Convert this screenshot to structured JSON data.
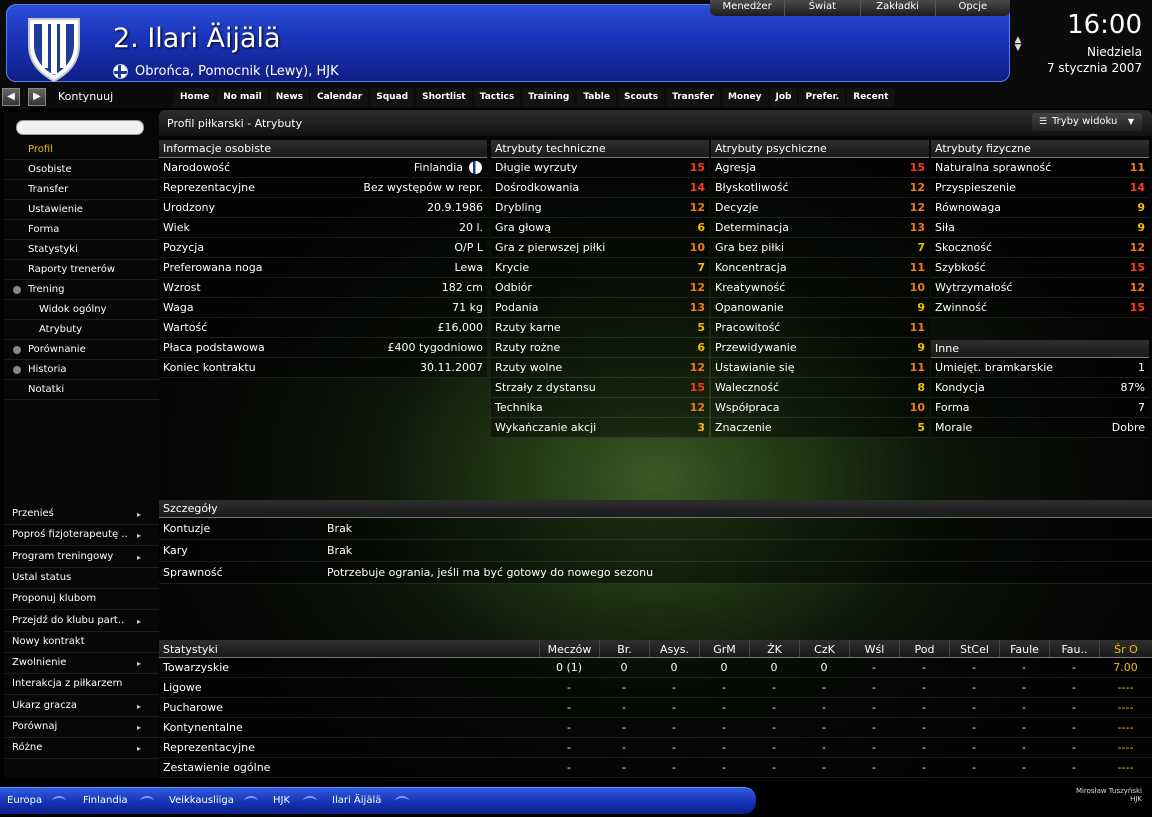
{
  "header": {
    "name": "2. Ilari Äijälä",
    "subtitle": "Obrońca, Pomocnik (Lewy), HJK",
    "menu": [
      "Menedżer",
      "Świat",
      "Zakładki",
      "Opcje"
    ],
    "time": "16:00",
    "day": "Niedziela",
    "date": "7 stycznia 2007",
    "colors": {
      "banner": "#1a33b8",
      "shield": "#1e3c9c"
    }
  },
  "nav": {
    "continue_label": "Kontynuuj",
    "links": [
      "Home",
      "No mail",
      "News",
      "Calendar",
      "Squad",
      "Shortlist",
      "Tactics",
      "Training",
      "Table",
      "Scouts",
      "Transfer",
      "Money",
      "Job",
      "Prefer.",
      "Recent"
    ]
  },
  "sidebar": {
    "items": [
      {
        "label": "Profil",
        "active": true,
        "sub": false,
        "icon": ""
      },
      {
        "label": "Osobiste",
        "active": false,
        "sub": false,
        "icon": ""
      },
      {
        "label": "Transfer",
        "active": false,
        "sub": false,
        "icon": ""
      },
      {
        "label": "Ustawienie",
        "active": false,
        "sub": false,
        "icon": ""
      },
      {
        "label": "Forma",
        "active": false,
        "sub": false,
        "icon": ""
      },
      {
        "label": "Statystyki",
        "active": false,
        "sub": false,
        "icon": ""
      },
      {
        "label": "Raporty trenerów",
        "active": false,
        "sub": false,
        "icon": ""
      },
      {
        "label": "Trening",
        "active": false,
        "sub": false,
        "icon": "collapse-icon"
      },
      {
        "label": "Widok ogólny",
        "active": false,
        "sub": true,
        "icon": ""
      },
      {
        "label": "Atrybuty",
        "active": false,
        "sub": true,
        "icon": ""
      },
      {
        "label": "Porównanie",
        "active": false,
        "sub": false,
        "icon": "expand-icon"
      },
      {
        "label": "Historia",
        "active": false,
        "sub": false,
        "icon": "expand-icon"
      },
      {
        "label": "Notatki",
        "active": false,
        "sub": false,
        "icon": ""
      }
    ],
    "actions": [
      "Przenieś",
      "Poproś fizjoterapeutę ..",
      "Program treningowy",
      "Ustal status",
      "Proponuj klubom",
      "Przejdź do klubu part..",
      "Nowy kontrakt",
      "Zwolnienie",
      "Interakcja z piłkarzem",
      "Ukarz gracza",
      "Porównaj",
      "Różne"
    ],
    "actions_with_arrow": [
      0,
      1,
      2,
      5,
      7,
      9,
      10,
      11
    ]
  },
  "main": {
    "title": "Profil piłkarski - Atrybuty",
    "view_button": "Tryby widoku"
  },
  "personal": {
    "header": "Informacje osobiste",
    "rows": [
      {
        "k": "Narodowość",
        "v": "Finlandia"
      },
      {
        "k": "Reprezentacyjne",
        "v": "Bez występów w repr."
      },
      {
        "k": "Urodzony",
        "v": "20.9.1986"
      },
      {
        "k": "Wiek",
        "v": "20 l."
      },
      {
        "k": "Pozycja",
        "v": "O/P L"
      },
      {
        "k": "Preferowana noga",
        "v": "Lewa"
      },
      {
        "k": "Wzrost",
        "v": "182 cm"
      },
      {
        "k": "Waga",
        "v": "71 kg"
      },
      {
        "k": "Wartość",
        "v": "£16,000"
      },
      {
        "k": "Płaca podstawowa",
        "v": "£400 tygodniowo"
      },
      {
        "k": "Koniec kontraktu",
        "v": "30.11.2007"
      }
    ]
  },
  "technical": {
    "header": "Atrybuty techniczne",
    "rows": [
      {
        "k": "Długie wyrzuty",
        "v": "15",
        "c": "r"
      },
      {
        "k": "Dośrodkowania",
        "v": "14",
        "c": "r"
      },
      {
        "k": "Drybling",
        "v": "12",
        "c": "o"
      },
      {
        "k": "Gra głową",
        "v": "6",
        "c": "y"
      },
      {
        "k": "Gra z pierwszej piłki",
        "v": "10",
        "c": "o"
      },
      {
        "k": "Krycie",
        "v": "7",
        "c": "y"
      },
      {
        "k": "Odbiór",
        "v": "12",
        "c": "o"
      },
      {
        "k": "Podania",
        "v": "13",
        "c": "o"
      },
      {
        "k": "Rzuty karne",
        "v": "5",
        "c": "y"
      },
      {
        "k": "Rzuty rożne",
        "v": "6",
        "c": "y"
      },
      {
        "k": "Rzuty wolne",
        "v": "12",
        "c": "o"
      },
      {
        "k": "Strzały z dystansu",
        "v": "15",
        "c": "r"
      },
      {
        "k": "Technika",
        "v": "12",
        "c": "o"
      },
      {
        "k": "Wykańczanie akcji",
        "v": "3",
        "c": "y"
      }
    ]
  },
  "mental": {
    "header": "Atrybuty psychiczne",
    "rows": [
      {
        "k": "Agresja",
        "v": "15",
        "c": "r"
      },
      {
        "k": "Błyskotliwość",
        "v": "12",
        "c": "o"
      },
      {
        "k": "Decyzje",
        "v": "12",
        "c": "o"
      },
      {
        "k": "Determinacja",
        "v": "13",
        "c": "o"
      },
      {
        "k": "Gra bez piłki",
        "v": "7",
        "c": "y"
      },
      {
        "k": "Koncentracja",
        "v": "11",
        "c": "o"
      },
      {
        "k": "Kreatywność",
        "v": "10",
        "c": "o"
      },
      {
        "k": "Opanowanie",
        "v": "9",
        "c": "y"
      },
      {
        "k": "Pracowitość",
        "v": "11",
        "c": "o"
      },
      {
        "k": "Przewidywanie",
        "v": "9",
        "c": "y"
      },
      {
        "k": "Ustawianie się",
        "v": "11",
        "c": "o"
      },
      {
        "k": "Waleczność",
        "v": "8",
        "c": "y"
      },
      {
        "k": "Współpraca",
        "v": "10",
        "c": "o"
      },
      {
        "k": "Znaczenie",
        "v": "5",
        "c": "y"
      }
    ]
  },
  "physical": {
    "header": "Atrybuty fizyczne",
    "rows": [
      {
        "k": "Naturalna sprawność",
        "v": "11",
        "c": "o"
      },
      {
        "k": "Przyspieszenie",
        "v": "14",
        "c": "r"
      },
      {
        "k": "Równowaga",
        "v": "9",
        "c": "y"
      },
      {
        "k": "Siła",
        "v": "9",
        "c": "y"
      },
      {
        "k": "Skoczność",
        "v": "12",
        "c": "o"
      },
      {
        "k": "Szybkość",
        "v": "15",
        "c": "r"
      },
      {
        "k": "Wytrzymałość",
        "v": "12",
        "c": "o"
      },
      {
        "k": "Zwinność",
        "v": "15",
        "c": "r"
      }
    ]
  },
  "other": {
    "header": "Inne",
    "rows": [
      {
        "k": "Umiejęt. bramkarskie",
        "v": "1"
      },
      {
        "k": "Kondycja",
        "v": "87%"
      },
      {
        "k": "Forma",
        "v": "7"
      },
      {
        "k": "Morale",
        "v": "Dobre"
      }
    ]
  },
  "details": {
    "header": "Szczegóły",
    "rows": [
      {
        "k": "Kontuzje",
        "v": "Brak"
      },
      {
        "k": "Kary",
        "v": "Brak"
      },
      {
        "k": "Sprawność",
        "v": "Potrzebuje ogrania, jeśli ma być gotowy do nowego sezonu"
      }
    ]
  },
  "stats": {
    "columns": [
      "Statystyki",
      "Meczów",
      "Br.",
      "Asys.",
      "GrM",
      "ŻK",
      "CzK",
      "Wśl",
      "Pod",
      "StCel",
      "Faule",
      "Fau..",
      "Śr O"
    ],
    "rows": [
      [
        "Towarzyskie",
        "0 (1)",
        "0",
        "0",
        "0",
        "0",
        "0",
        "-",
        "-",
        "-",
        "-",
        "-",
        "7.00"
      ],
      [
        "Ligowe",
        "-",
        "-",
        "-",
        "-",
        "-",
        "-",
        "-",
        "-",
        "-",
        "-",
        "-",
        "----"
      ],
      [
        "Pucharowe",
        "-",
        "-",
        "-",
        "-",
        "-",
        "-",
        "-",
        "-",
        "-",
        "-",
        "-",
        "----"
      ],
      [
        "Kontynentalne",
        "-",
        "-",
        "-",
        "-",
        "-",
        "-",
        "-",
        "-",
        "-",
        "-",
        "-",
        "----"
      ],
      [
        "Reprezentacyjne",
        "-",
        "-",
        "-",
        "-",
        "-",
        "-",
        "-",
        "-",
        "-",
        "-",
        "-",
        "----"
      ],
      [
        "Zestawienie ogólne",
        "-",
        "-",
        "-",
        "-",
        "-",
        "-",
        "-",
        "-",
        "-",
        "-",
        "-",
        "----"
      ]
    ]
  },
  "statusbar": {
    "crumbs": [
      "Europa",
      "Finlandia",
      "Veikkausliiga",
      "HJK",
      "Ilari Äijälä"
    ],
    "user": "Mirosław Tuszyński",
    "club": "HJK"
  }
}
